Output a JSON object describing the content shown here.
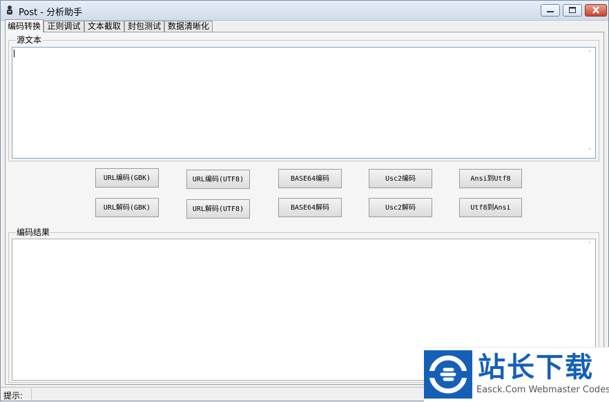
{
  "window": {
    "title": "Post - 分析助手"
  },
  "tabs": [
    {
      "label": "编码转换",
      "active": true
    },
    {
      "label": "正则调试",
      "active": false
    },
    {
      "label": "文本截取",
      "active": false
    },
    {
      "label": "封包测试",
      "active": false
    },
    {
      "label": "数据清晰化",
      "active": false
    }
  ],
  "source": {
    "label": "源文本",
    "value": ""
  },
  "buttons": {
    "row1": [
      "URL编码(GBK)",
      "URL编码(UTF8)",
      "BASE64编码",
      "Usc2编码",
      "Ansi到Utf8"
    ],
    "row2": [
      "URL解码(GBK)",
      "URL解码(UTF8)",
      "BASE64解码",
      "Usc2解码",
      "Utf8到Ansi"
    ]
  },
  "result": {
    "label": "编码结果",
    "value": ""
  },
  "status": {
    "label": "提示:"
  },
  "watermark": {
    "cn": "站长下载",
    "en": "Easck.Com Webmaster Codes"
  },
  "colors": {
    "accent": "#1560b6",
    "textarea_border": "#7fa4bf"
  }
}
